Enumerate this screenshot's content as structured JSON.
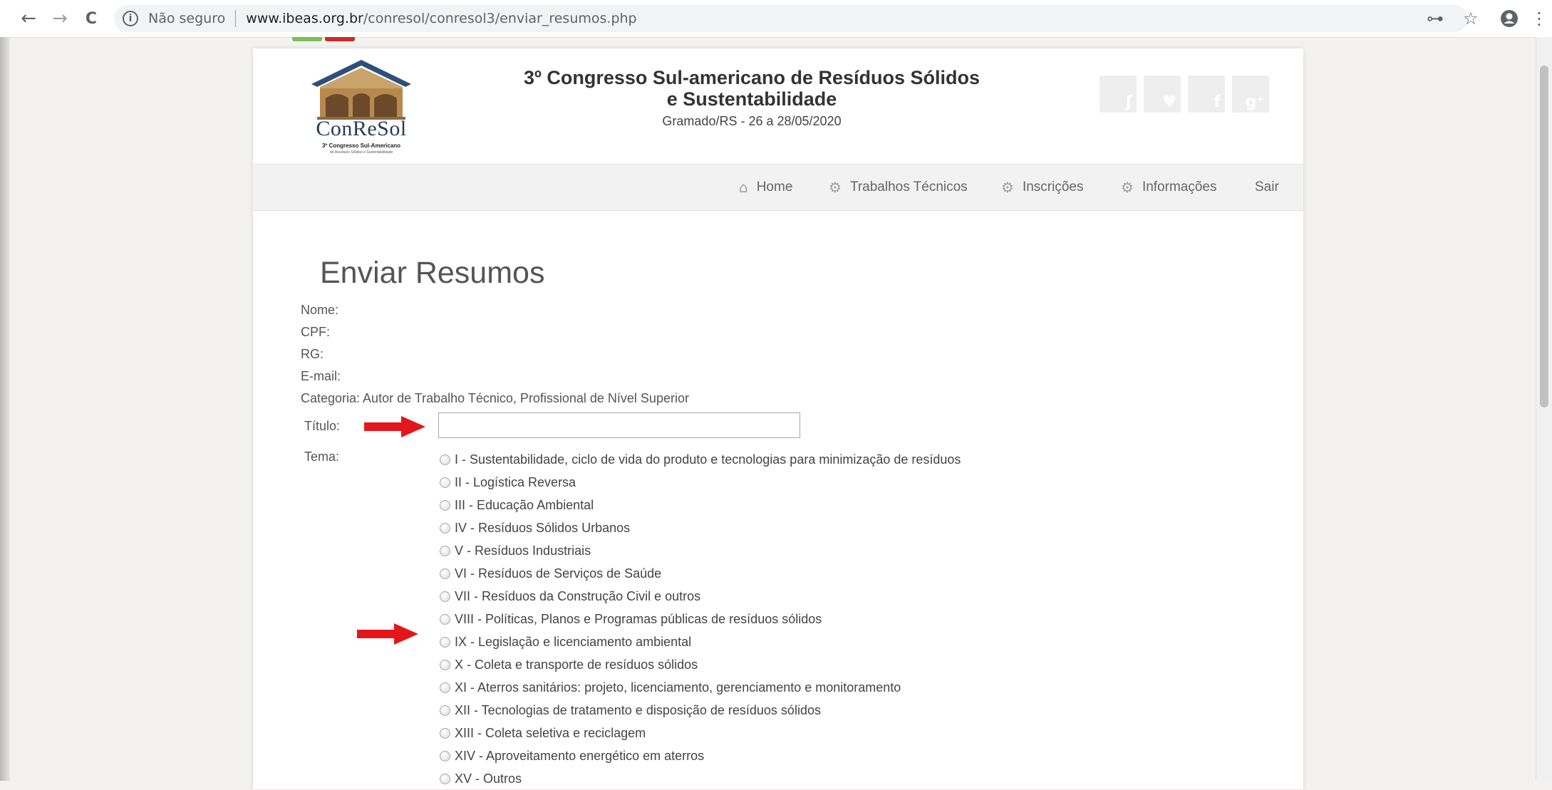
{
  "browser": {
    "back_icon": "←",
    "forward_icon": "→",
    "reload_icon": "C",
    "security_label": "Não seguro",
    "url_domain": "www.ibeas.org.br",
    "url_path": "/conresol/conresol3/enviar_resumos.php",
    "key_icon": "⊶",
    "star_icon": "☆",
    "menu_icon": "⋮"
  },
  "header": {
    "logo_word": "ConReSol",
    "logo_subtitle": "3º Congresso Sul-Americano",
    "logo_subtitle2": "de Resíduos Sólidos e Sustentabilidade",
    "title": "3º Congresso Sul-americano de Resíduos Sólidos e Sustentabilidade",
    "subtitle": "Gramado/RS - 26 a 28/05/2020",
    "social_icons": [
      "rss-icon",
      "twitter-icon",
      "facebook-icon",
      "google-plus-icon"
    ]
  },
  "menu": {
    "home": "Home",
    "trabalhos": "Trabalhos Técnicos",
    "inscricoes": "Inscrições",
    "informacoes": "Informações",
    "sair": "Sair"
  },
  "form": {
    "page_title": "Enviar Resumos",
    "nome_label": "Nome:",
    "cpf_label": "CPF:",
    "rg_label": "RG:",
    "email_label": "E-mail:",
    "categoria_line": "Categoria: Autor de Trabalho Técnico, Profissional de Nível Superior",
    "titulo_label": "Título:",
    "titulo_value": "",
    "tema_label": "Tema:",
    "temas": [
      "I - Sustentabilidade, ciclo de vida do produto e tecnologias para minimização de resíduos",
      "II - Logística Reversa",
      "III - Educação Ambiental",
      "IV - Resíduos Sólidos Urbanos",
      "V - Resíduos Industriais",
      "VI - Resíduos de Serviços de Saúde",
      "VII - Resíduos da Construção Civil e outros",
      "VIII - Políticas, Planos e Programas públicas de resíduos sólidos",
      "IX - Legislação e licenciamento ambiental",
      "X - Coleta e transporte de resíduos sólidos",
      "XI - Aterros sanitários: projeto, licenciamento, gerenciamento e monitoramento",
      "XII - Tecnologias de tratamento e disposição de resíduos sólidos",
      "XIII - Coleta seletiva e reciclagem",
      "XIV - Aproveitamento energético em aterros",
      "XV - Outros"
    ]
  },
  "colors": {
    "arrow": "#e3161b",
    "page_bg": "#f4f2ee",
    "menubar_bg": "#f2f2f2"
  }
}
